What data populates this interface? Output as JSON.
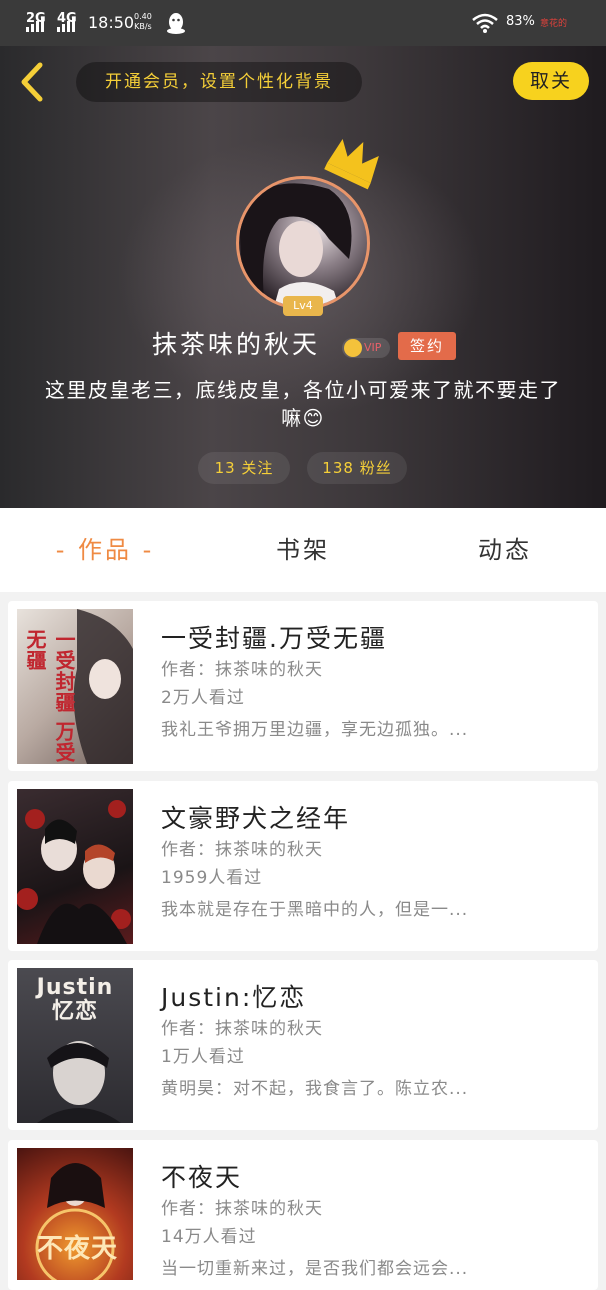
{
  "status_bar": {
    "network_1": "2G",
    "network_2": "4G",
    "time": "18:50",
    "speed_value": "0.40",
    "speed_unit": "KB/s",
    "battery": "83%",
    "carrier": "意花的"
  },
  "header": {
    "back_icon": "chevron-left-icon",
    "member_banner": "开通会员，设置个性化背景",
    "unfollow_button": "取关",
    "level": "Lv4",
    "nickname": "抹茶味的秋天",
    "vip_label": "VIP",
    "sign_label": "签约",
    "bio_line1": "这里皮皇老三，底线皮皇，各位小可爱来了就不要走了",
    "bio_line2": "嘛😊",
    "following": "13 关注",
    "fans": "138 粉丝"
  },
  "tabs": [
    {
      "label": "- 作品 -",
      "active": true
    },
    {
      "label": "书架",
      "active": false
    },
    {
      "label": "动态",
      "active": false
    }
  ],
  "works": [
    {
      "title": "一受封疆.万受无疆",
      "author": "作者：抹茶味的秋天",
      "views": "2万人看过",
      "desc": "我礼王爷拥万里边疆，享无边孤独。...",
      "cover_text": "一受封疆 万受无疆",
      "cover_color": "#d8cfc7"
    },
    {
      "title": "文豪野犬之经年",
      "author": "作者：抹茶味的秋天",
      "views": "1959人看过",
      "desc": "我本就是存在于黑暗中的人，但是一...",
      "cover_text": "",
      "cover_color": "#2a2226"
    },
    {
      "title": "Justin:忆恋",
      "author": "作者：抹茶味的秋天",
      "views": "1万人看过",
      "desc": "黄明昊：对不起，我食言了。陈立农...",
      "cover_text": "Justin 忆恋",
      "cover_color": "#3c3b40"
    },
    {
      "title": "不夜天",
      "author": "作者：抹茶味的秋天",
      "views": "14万人看过",
      "desc": "当一切重新来过，是否我们都会远会...",
      "cover_text": "不夜天",
      "cover_color": "#7a2a24"
    }
  ],
  "colors": {
    "accent_yellow": "#f5cf38",
    "tab_active": "#ef8a43",
    "sign_badge": "#e36b4a"
  }
}
